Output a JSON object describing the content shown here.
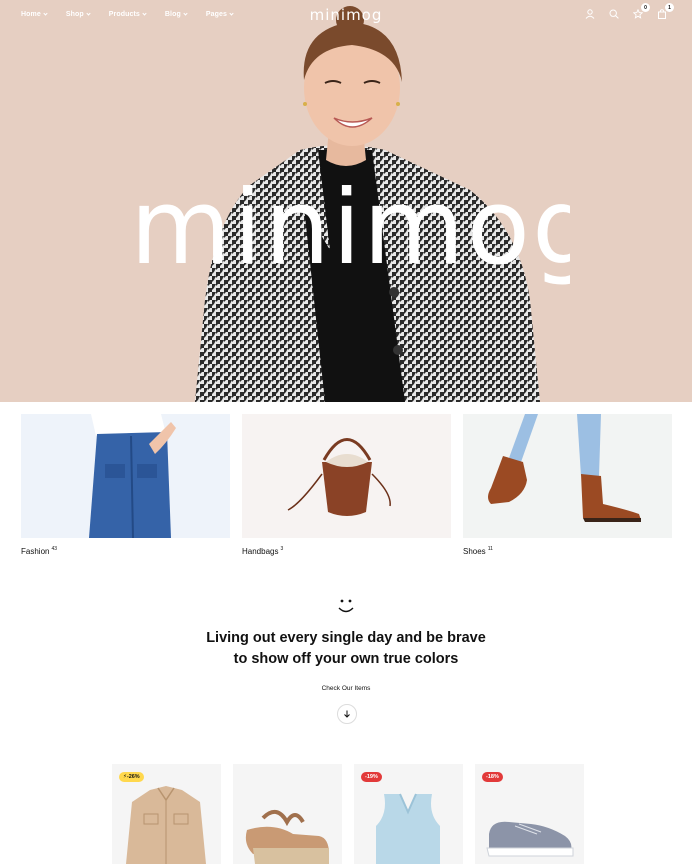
{
  "nav": {
    "links": [
      {
        "label": "Home"
      },
      {
        "label": "Shop"
      },
      {
        "label": "Products"
      },
      {
        "label": "Blog"
      },
      {
        "label": "Pages"
      }
    ],
    "logo": "minimog",
    "wishlist_count": "0",
    "cart_count": "1",
    "icons": [
      "user-icon",
      "search-icon",
      "star-icon",
      "bag-icon"
    ]
  },
  "hero": {
    "wordmark": "minimog",
    "background": "#e6cfc2"
  },
  "categories": [
    {
      "name": "Fashion",
      "count": "43"
    },
    {
      "name": "Handbags",
      "count": "3"
    },
    {
      "name": "Shoes",
      "count": "11"
    }
  ],
  "tagline": {
    "line1": "Living out every single day and be brave",
    "line2": "to show off your own true colors",
    "cta": "Check Our Items"
  },
  "products": [
    {
      "badge": "⚡-26%",
      "badge_color": "#ffd84d"
    },
    {
      "badge": "",
      "badge_color": ""
    },
    {
      "badge": "-19%",
      "badge_color": "#e23a3a"
    },
    {
      "badge": "-18%",
      "badge_color": "#e23a3a"
    }
  ]
}
